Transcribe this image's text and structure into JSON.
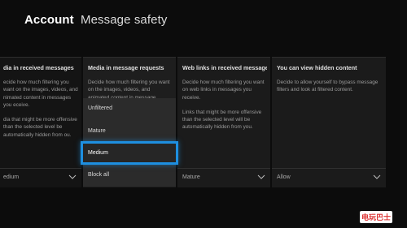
{
  "header": {
    "section": "Account",
    "title": "Message safety"
  },
  "columns": [
    {
      "heading": "dia in received messages",
      "desc1": "ecide how much filtering you want on the images, videos, and nimated content in messages you eceive.",
      "desc2": "dia that might be more offensive than the selected level be automatically hidden from ou.",
      "value": "edium"
    },
    {
      "heading": "Media in message requests",
      "desc1": "Decide how much filtering you want on the images, videos, and animated content in message",
      "desc2": "",
      "value": ""
    },
    {
      "heading": "Web links in received messages",
      "desc1": "Decide how much filtering you want on web links in messages you receive.",
      "desc2": "Links that might be more offensive than the selected level will be automatically hidden from you.",
      "value": "Mature"
    },
    {
      "heading": "You can view hidden content",
      "desc1": "Decide to allow yourself to bypass message filters and look at filtered content.",
      "desc2": "",
      "value": "Allow"
    }
  ],
  "dropdown": {
    "options": [
      "Unfiltered",
      "Mature",
      "Medium",
      "Block all"
    ],
    "selected": "Medium"
  },
  "colors": {
    "focus": "#1e8fe0",
    "background": "#0c0c0c"
  },
  "watermark": "电玩巴士"
}
